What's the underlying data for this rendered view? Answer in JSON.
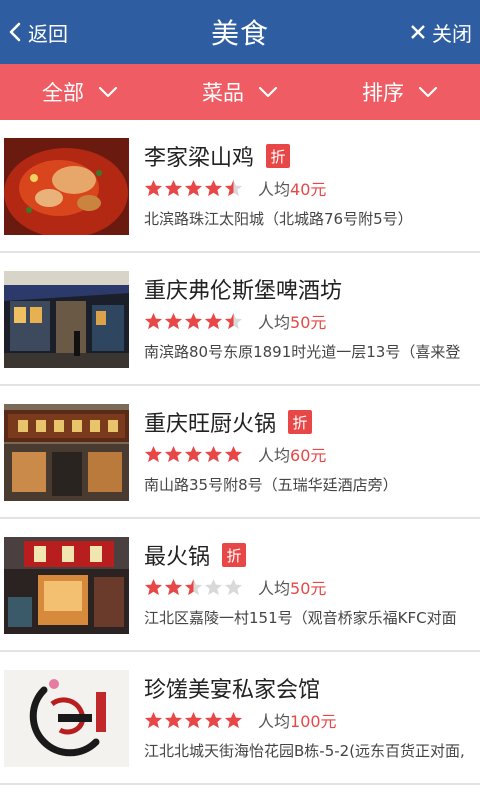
{
  "header": {
    "back_label": "返回",
    "title": "美食",
    "close_label": "关闭"
  },
  "filters": [
    {
      "label": "全部"
    },
    {
      "label": "菜品"
    },
    {
      "label": "排序"
    }
  ],
  "colors": {
    "header_bg": "#2e5ea1",
    "filter_bg": "#ef5c63",
    "accent_red": "#e84747",
    "star_empty": "#d9d9d9"
  },
  "restaurants": [
    {
      "name": "李家梁山鸡",
      "discount": "折",
      "has_discount": true,
      "rating": 4.5,
      "avg_prefix": "人均",
      "price": "40元",
      "address": "北滨路珠江太阳城（北城路76号附5号）",
      "thumb_icon": "spicy-chicken-dish-photo"
    },
    {
      "name": "重庆弗伦斯堡啤酒坊",
      "discount": "",
      "has_discount": false,
      "rating": 4.5,
      "avg_prefix": "人均",
      "price": "50元",
      "address": "南滨路80号东原1891时光道一层13号（喜来登",
      "thumb_icon": "beer-bar-storefront-photo"
    },
    {
      "name": "重庆旺厨火锅",
      "discount": "折",
      "has_discount": true,
      "rating": 5,
      "avg_prefix": "人均",
      "price": "60元",
      "address": "南山路35号附8号（五瑞华廷酒店旁）",
      "thumb_icon": "hotpot-restaurant-storefront-photo"
    },
    {
      "name": "最火锅",
      "discount": "折",
      "has_discount": true,
      "rating": 2.5,
      "avg_prefix": "人均",
      "price": "50元",
      "address": "江北区嘉陵一村151号（观音桥家乐福KFC对面",
      "thumb_icon": "hotpot-shop-storefront-photo"
    },
    {
      "name": "珍馐美宴私家会馆",
      "discount": "",
      "has_discount": false,
      "rating": 5,
      "avg_prefix": "人均",
      "price": "100元",
      "address": "江北北城天街海怡花园B栋-5-2(远东百货正对面,",
      "thumb_icon": "restaurant-logo-photo"
    }
  ]
}
